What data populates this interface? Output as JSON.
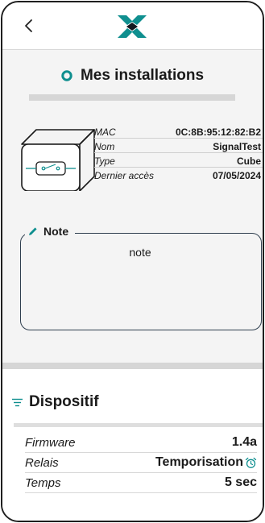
{
  "header": {
    "back_icon": "chevron-left-icon",
    "logo_icon": "brand-x-logo"
  },
  "page": {
    "title": "Mes installations",
    "title_icon": "circle-icon",
    "accent_color": "#0f8f8f"
  },
  "installation": {
    "device_icon": "cube-relay-icon",
    "rows": [
      {
        "key": "MAC",
        "value": "0C:8B:95:12:82:B2"
      },
      {
        "key": "Nom",
        "value": "SignalTest"
      },
      {
        "key": "Type",
        "value": "Cube"
      },
      {
        "key": "Dernier accès",
        "value": "07/05/2024"
      }
    ]
  },
  "note": {
    "label": "Note",
    "value": "note",
    "icon": "pencil-icon"
  },
  "dispositif": {
    "title": "Dispositif",
    "icon": "list-icon",
    "rows": [
      {
        "key": "Firmware",
        "value": "1.4a"
      },
      {
        "key": "Relais",
        "value": "Temporisation",
        "icon": "alarm-clock-icon"
      },
      {
        "key": "Temps",
        "value": "5 sec"
      }
    ]
  }
}
